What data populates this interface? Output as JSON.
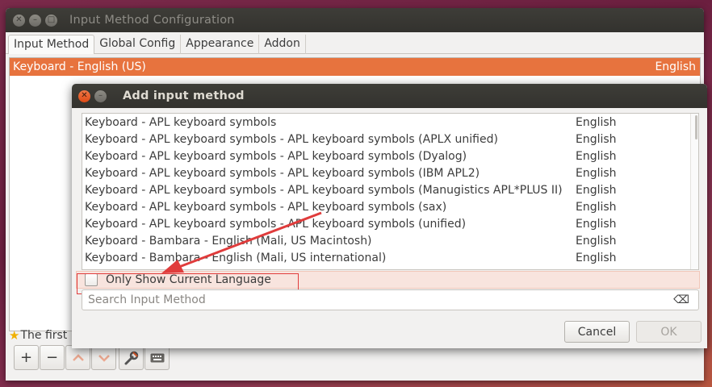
{
  "main_window": {
    "title": "Input Method Configuration",
    "tabs": [
      {
        "label": "Input Method"
      },
      {
        "label": "Global Config"
      },
      {
        "label": "Appearance"
      },
      {
        "label": "Addon"
      }
    ],
    "selected_item": {
      "name": "Keyboard - English (US)",
      "lang": "English"
    },
    "first_msg": "The first"
  },
  "dialog": {
    "title": "Add input method",
    "items": [
      {
        "name": "Keyboard - APL keyboard symbols",
        "lang": "English"
      },
      {
        "name": "Keyboard - APL keyboard symbols - APL keyboard symbols (APLX unified)",
        "lang": "English"
      },
      {
        "name": "Keyboard - APL keyboard symbols - APL keyboard symbols (Dyalog)",
        "lang": "English"
      },
      {
        "name": "Keyboard - APL keyboard symbols - APL keyboard symbols (IBM APL2)",
        "lang": "English"
      },
      {
        "name": "Keyboard - APL keyboard symbols - APL keyboard symbols (Manugistics APL*PLUS II)",
        "lang": "English"
      },
      {
        "name": "Keyboard - APL keyboard symbols - APL keyboard symbols (sax)",
        "lang": "English"
      },
      {
        "name": "Keyboard - APL keyboard symbols - APL keyboard symbols (unified)",
        "lang": "English"
      },
      {
        "name": "Keyboard - Bambara - English (Mali, US Macintosh)",
        "lang": "English"
      },
      {
        "name": "Keyboard - Bambara - English (Mali, US international)",
        "lang": "English"
      }
    ],
    "only_show_label": "Only Show Current Language",
    "search_placeholder": "Search Input Method",
    "cancel_label": "Cancel",
    "ok_label": "OK"
  },
  "colors": {
    "selection": "#e7733e",
    "annotation_red": "#e03c3c"
  },
  "icons": {
    "close": "close-icon",
    "minimize": "minimize-icon",
    "star": "star-icon",
    "add": "plus-icon",
    "remove": "minus-icon",
    "up": "chevron-up-icon",
    "down": "chevron-down-icon",
    "configure": "wrench-icon",
    "keyboard": "keyboard-icon",
    "clear": "clear-icon"
  }
}
